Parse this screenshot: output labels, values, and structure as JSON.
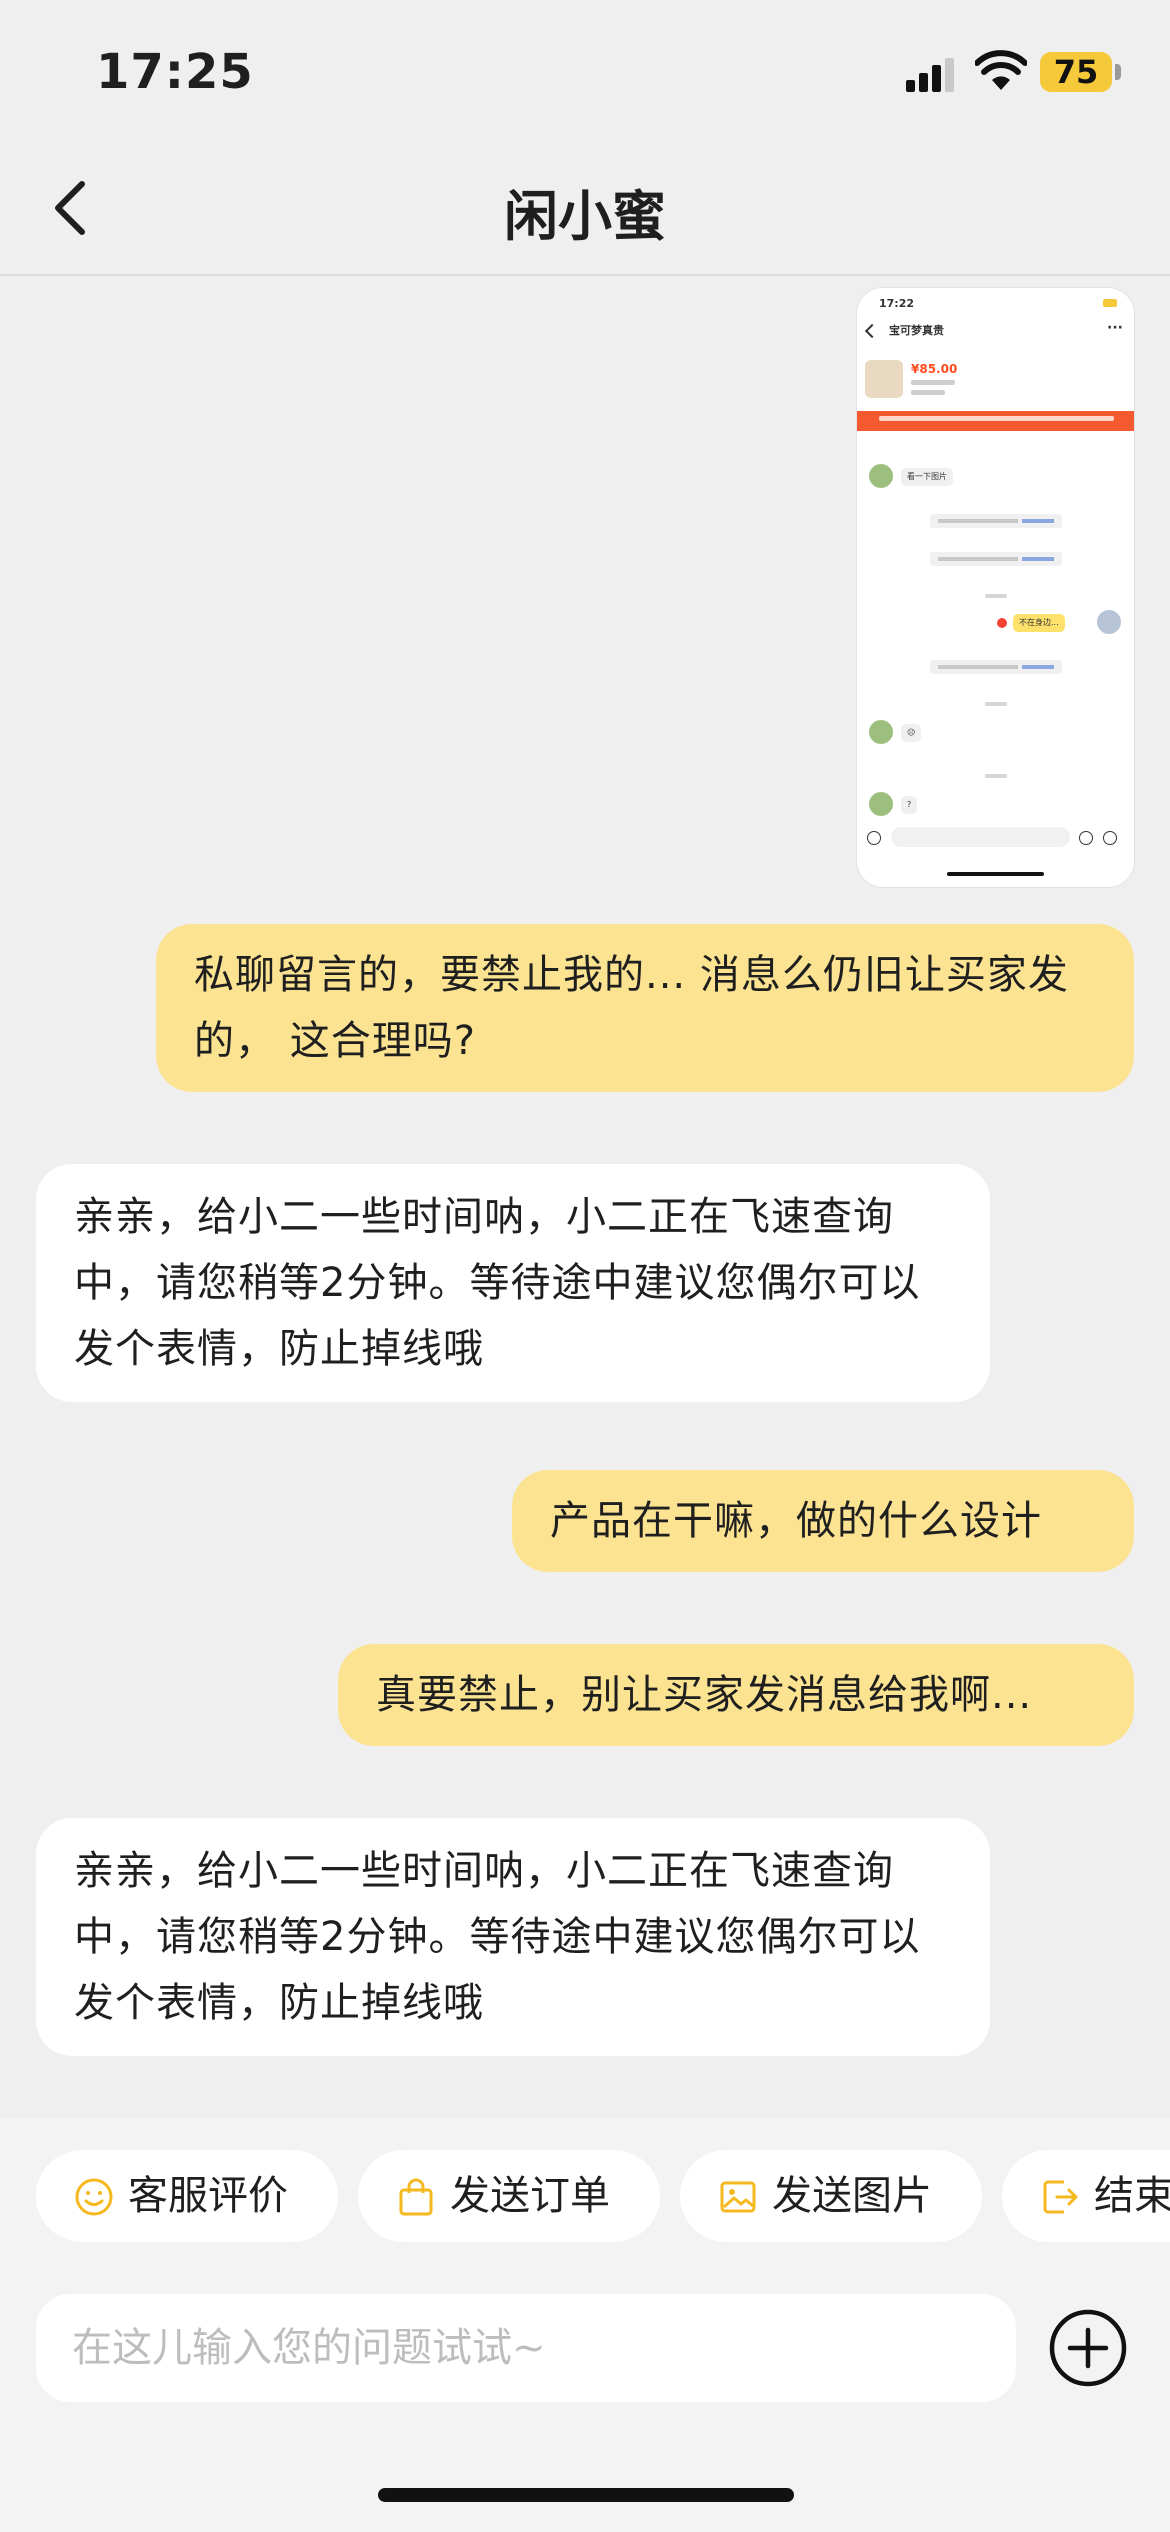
{
  "status_bar": {
    "time": "17:25",
    "battery": "75"
  },
  "nav": {
    "title": "闲小蜜"
  },
  "thumbnail": {
    "time": "17:22",
    "title": "宝可梦真贵",
    "price": "¥85.00",
    "bubble_1": "看一下图片",
    "bubble_self": "不在身边...",
    "bubble_emoji": "☹",
    "bubble_q": "?"
  },
  "messages": [
    {
      "role": "user",
      "text": "私聊留言的，要禁止我的... 消息么仍旧让买家发的，  这合理吗?"
    },
    {
      "role": "agent",
      "text": "亲亲，给小二一些时间呐，小二正在飞速查询中，请您稍等2分钟。等待途中建议您偶尔可以发个表情，防止掉线哦"
    },
    {
      "role": "user",
      "text": "产品在干嘛，做的什么设计"
    },
    {
      "role": "user",
      "text": "真要禁止，别让买家发消息给我啊..."
    },
    {
      "role": "agent",
      "text": "亲亲，给小二一些时间呐，小二正在飞速查询中，请您稍等2分钟。等待途中建议您偶尔可以发个表情，防止掉线哦"
    }
  ],
  "quick_actions": [
    {
      "label": "客服评价",
      "icon": "smile-icon"
    },
    {
      "label": "发送订单",
      "icon": "bag-icon"
    },
    {
      "label": "发送图片",
      "icon": "image-icon"
    },
    {
      "label": "结束",
      "icon": "exit-icon"
    }
  ],
  "input": {
    "placeholder": "在这儿输入您的问题试试~"
  },
  "colors": {
    "accent": "#f5b81f",
    "user_bubble": "#fbe392",
    "background": "#efefef"
  }
}
